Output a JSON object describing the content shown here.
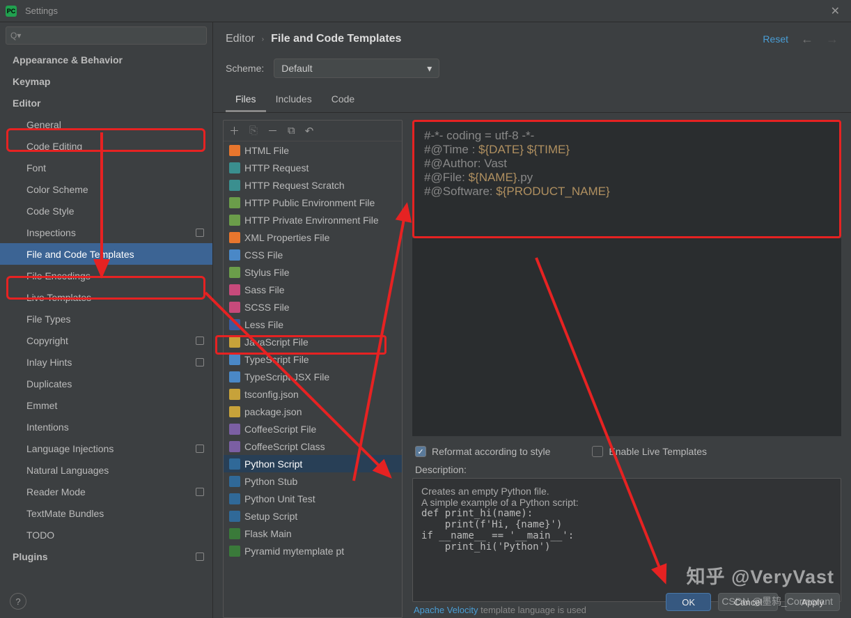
{
  "window": {
    "title": "Settings"
  },
  "breadcrumb": {
    "parent": "Editor",
    "current": "File and Code Templates",
    "reset": "Reset"
  },
  "scheme": {
    "label": "Scheme:",
    "value": "Default"
  },
  "tabs": [
    "Files",
    "Includes",
    "Code"
  ],
  "sidebar": {
    "items": [
      {
        "label": "Appearance & Behavior",
        "bold": true,
        "arrow": ">",
        "lvl": 1
      },
      {
        "label": "Keymap",
        "bold": true,
        "lvl": 1
      },
      {
        "label": "Editor",
        "bold": true,
        "arrow": "v",
        "lvl": 1
      },
      {
        "label": "General",
        "arrow": ">",
        "lvl": 2
      },
      {
        "label": "Code Editing",
        "lvl": 2
      },
      {
        "label": "Font",
        "lvl": 2
      },
      {
        "label": "Color Scheme",
        "arrow": ">",
        "lvl": 2
      },
      {
        "label": "Code Style",
        "arrow": ">",
        "lvl": 2
      },
      {
        "label": "Inspections",
        "badge": true,
        "lvl": 2
      },
      {
        "label": "File and Code Templates",
        "selected": true,
        "lvl": 2
      },
      {
        "label": "File Encodings",
        "lvl": 2
      },
      {
        "label": "Live Templates",
        "lvl": 2
      },
      {
        "label": "File Types",
        "lvl": 2
      },
      {
        "label": "Copyright",
        "arrow": ">",
        "badge": true,
        "lvl": 2
      },
      {
        "label": "Inlay Hints",
        "badge": true,
        "lvl": 2
      },
      {
        "label": "Duplicates",
        "lvl": 2
      },
      {
        "label": "Emmet",
        "arrow": ">",
        "lvl": 2
      },
      {
        "label": "Intentions",
        "lvl": 2
      },
      {
        "label": "Language Injections",
        "badge": true,
        "lvl": 2
      },
      {
        "label": "Natural Languages",
        "arrow": ">",
        "lvl": 2
      },
      {
        "label": "Reader Mode",
        "badge": true,
        "lvl": 2
      },
      {
        "label": "TextMate Bundles",
        "lvl": 2
      },
      {
        "label": "TODO",
        "lvl": 2
      },
      {
        "label": "Plugins",
        "bold": true,
        "badge": true,
        "lvl": 1
      }
    ]
  },
  "filelist": [
    {
      "label": "HTML File",
      "c": "c-orange"
    },
    {
      "label": "HTTP Request",
      "c": "c-teal"
    },
    {
      "label": "HTTP Request Scratch",
      "c": "c-teal"
    },
    {
      "label": "HTTP Public Environment File",
      "c": "c-green"
    },
    {
      "label": "HTTP Private Environment File",
      "c": "c-green"
    },
    {
      "label": "XML Properties File",
      "c": "c-orange"
    },
    {
      "label": "CSS File",
      "c": "c-blue"
    },
    {
      "label": "Stylus File",
      "c": "c-green"
    },
    {
      "label": "Sass File",
      "c": "c-pink"
    },
    {
      "label": "SCSS File",
      "c": "c-pink"
    },
    {
      "label": "Less File",
      "c": "c-dblue"
    },
    {
      "label": "JavaScript File",
      "c": "c-yellow"
    },
    {
      "label": "TypeScript File",
      "c": "c-blue"
    },
    {
      "label": "TypeScript JSX File",
      "c": "c-blue"
    },
    {
      "label": "tsconfig.json",
      "c": "c-yellow"
    },
    {
      "label": "package.json",
      "c": "c-yellow"
    },
    {
      "label": "CoffeeScript File",
      "c": "c-purple"
    },
    {
      "label": "CoffeeScript Class",
      "c": "c-purple"
    },
    {
      "label": "Python Script",
      "c": "c-py",
      "sel": true
    },
    {
      "label": "Python Stub",
      "c": "c-py"
    },
    {
      "label": "Python Unit Test",
      "c": "c-py"
    },
    {
      "label": "Setup Script",
      "c": "c-py"
    },
    {
      "label": "Flask Main",
      "c": "c-dgreen"
    },
    {
      "label": "Pyramid mytemplate pt",
      "c": "c-dgreen"
    }
  ],
  "code": {
    "l1a": "#-*- coding = utf-8 -*-",
    "l2a": "#@Time : ",
    "l2b": "${DATE} ${TIME}",
    "l3": "#@Author: Vast",
    "l4a": "#@File: ",
    "l4b": "${NAME}",
    "l4c": ".py",
    "l5a": "#@Software: ",
    "l5b": "${PRODUCT_NAME}"
  },
  "checks": {
    "reformat": "Reformat according to style",
    "live": "Enable Live Templates"
  },
  "desc": {
    "label": "Description:",
    "t1": "Creates an empty Python file.",
    "t2": "A simple example of a Python script:",
    "c1": "def print_hi(name):",
    "c2": "    print(f'Hi, {name}')",
    "c3": "",
    "c4": "if __name__ == '__main__':",
    "c5": "    print_hi('Python')"
  },
  "footer": {
    "link": "Apache Velocity",
    "rest": " template language is used"
  },
  "buttons": {
    "ok": "OK",
    "cancel": "Cancel",
    "apply": "Apply"
  },
  "watermark1": "知乎 @VeryVast",
  "watermark2": "CSDN @墨鸫_Cormorant"
}
